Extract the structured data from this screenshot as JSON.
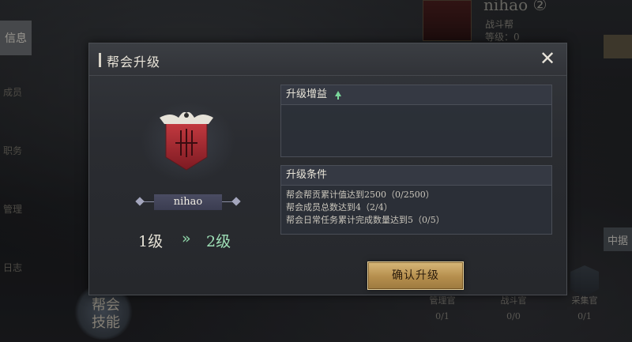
{
  "background": {
    "left_tab": "信息",
    "left_labels": [
      "成员",
      "职务",
      "管理",
      "日志"
    ],
    "top_name": "nihao ②",
    "top_sub1": "战斗帮",
    "top_sub2": "等级：0",
    "right_tab": "中据",
    "skill_button": "帮会技能",
    "officers": [
      {
        "label": "管理官",
        "count": "0/1"
      },
      {
        "label": "战斗官",
        "count": "0/0"
      },
      {
        "label": "采集官",
        "count": "0/1"
      }
    ]
  },
  "dialog": {
    "title": "帮会升级",
    "close_icon": "close-icon",
    "guild_name": "nihao",
    "level_from": "1级",
    "level_arrow": "»",
    "level_to": "2级",
    "gain_header": "升级增益",
    "conditions_header": "升级条件",
    "conditions": [
      "帮会帮贡累计值达到2500（0/2500）",
      "帮会成员总数达到4（2/4）",
      "帮会日常任务累计完成数量达到5（0/5）"
    ],
    "confirm_label": "确认升级"
  },
  "colors": {
    "accent_gold": "#c9a564",
    "level_green": "#9fe0b7",
    "emblem_red": "#b0323a"
  }
}
